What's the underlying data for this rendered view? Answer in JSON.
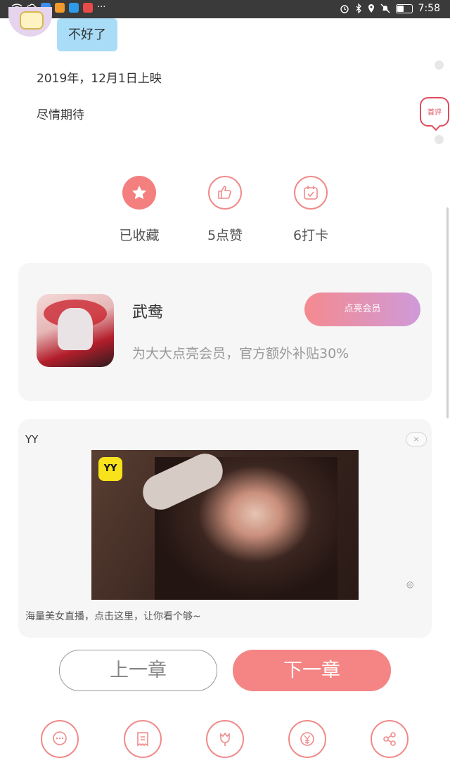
{
  "status_bar": {
    "time": "7:58",
    "more": "···",
    "icons": [
      "wifi-icon",
      "cloud-icon",
      "notification-icon",
      "app-icon",
      "search-icon",
      "app2-icon",
      "alarm-icon",
      "bluetooth-icon",
      "location-icon",
      "mute-icon",
      "battery-icon"
    ]
  },
  "chat": {
    "bubble_text": "不好了"
  },
  "content": {
    "line1": "2019年，12月1日上映",
    "line2": "尽情期待"
  },
  "side": {
    "first_comment": "首评"
  },
  "actions": [
    {
      "label": "已收藏",
      "icon": "star-icon"
    },
    {
      "label": "5点赞",
      "icon": "thumbs-up-icon"
    },
    {
      "label": "6打卡",
      "icon": "calendar-check-icon"
    }
  ],
  "author_card": {
    "name": "武鸯",
    "vip_button": "点亮会员",
    "description": "为大大点亮会员，官方额外补贴30%"
  },
  "ad": {
    "title": "YY",
    "close": "×",
    "logo_text": "YY",
    "mark": "◎",
    "description": "海量美女直播，点击这里，让你看个够~"
  },
  "nav": {
    "prev": "上一章",
    "next": "下一章"
  },
  "bottom_icons": [
    "comment-icon",
    "reward-list-icon",
    "flower-icon",
    "yuan-icon",
    "share-icon"
  ],
  "colors": {
    "accent": "#f58585",
    "bubble": "#a8dcf7",
    "statusbar": "#3a3a3a"
  }
}
